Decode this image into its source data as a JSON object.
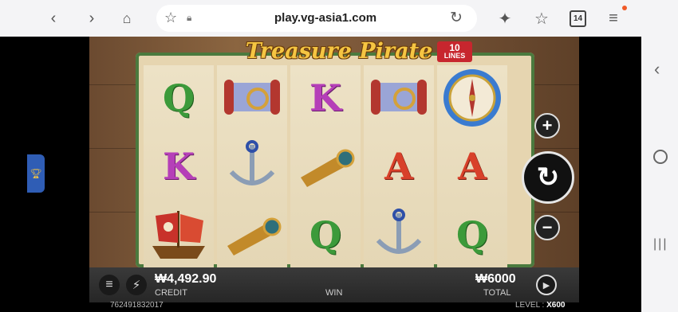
{
  "browser": {
    "url": "play.vg-asia1.com",
    "tab_count": "14",
    "icons": [
      "back-icon",
      "forward-icon",
      "home-icon",
      "star-icon",
      "lock-icon",
      "reload-icon",
      "sparkle-icon",
      "bookmark-star-icon",
      "tabs-icon",
      "menu-icon"
    ]
  },
  "game": {
    "title": "Treasure Pirate",
    "lines_number": "10",
    "lines_label": "LINES",
    "reels": [
      [
        "Q",
        "K",
        "ship"
      ],
      [
        "scroll",
        "anchor",
        "spyglass"
      ],
      [
        "K",
        "spyglass",
        "Q"
      ],
      [
        "scroll",
        "A",
        "anchor"
      ],
      [
        "compass",
        "A",
        "Q"
      ]
    ],
    "credit_value": "₩4,492.90",
    "credit_label": "CREDIT",
    "win_label": "WIN",
    "total_value": "₩6000",
    "total_label": "TOTAL",
    "session_id": "762491832017",
    "level_label": "LEVEL :",
    "level_value": "X600"
  },
  "colors": {
    "q_symbol": "#3c9a3a",
    "k_symbol": "#b53fb8",
    "a_symbol": "#d8402a",
    "title_gold": "#f5c542"
  }
}
